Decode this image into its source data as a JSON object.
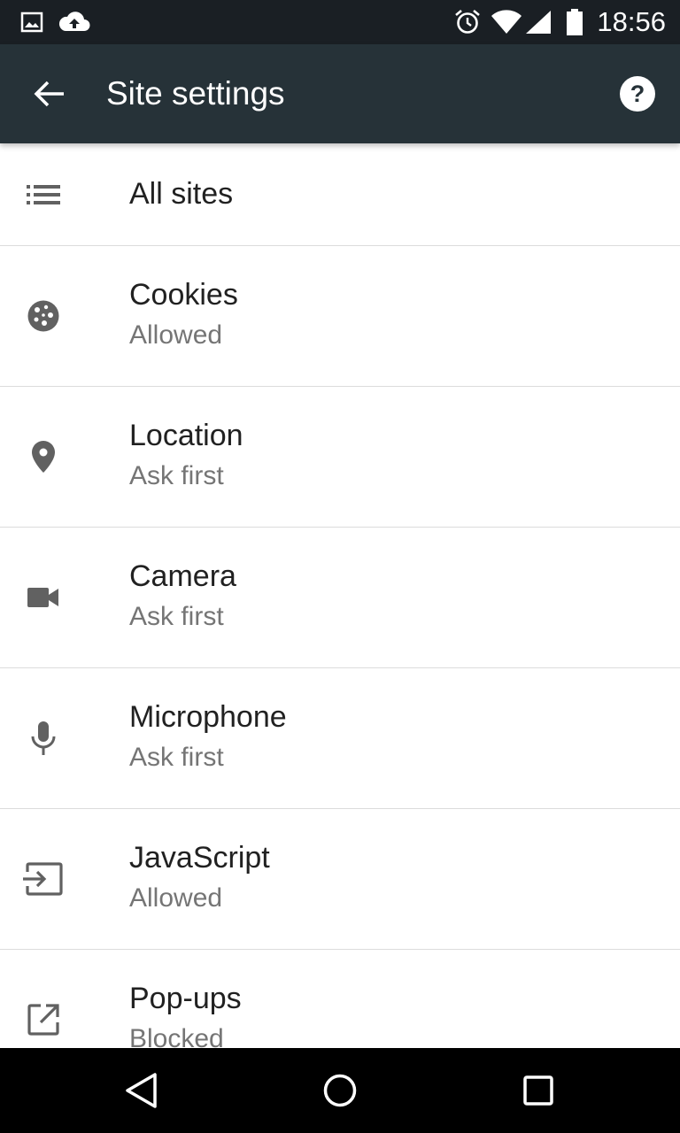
{
  "status_bar": {
    "time": "18:56",
    "left_icons": [
      "image-icon",
      "cloud-upload-icon"
    ],
    "right_icons": [
      "alarm-icon",
      "wifi-icon",
      "signal-icon",
      "battery-icon"
    ]
  },
  "toolbar": {
    "title": "Site settings",
    "back_icon": "arrow-back-icon",
    "help_icon": "help-icon"
  },
  "settings": {
    "items": [
      {
        "icon": "list-icon",
        "title": "All sites"
      },
      {
        "icon": "cookie-icon",
        "title": "Cookies",
        "summary": "Allowed"
      },
      {
        "icon": "location-pin-icon",
        "title": "Location",
        "summary": "Ask first"
      },
      {
        "icon": "videocam-icon",
        "title": "Camera",
        "summary": "Ask first"
      },
      {
        "icon": "microphone-icon",
        "title": "Microphone",
        "summary": "Ask first"
      },
      {
        "icon": "javascript-icon",
        "title": "JavaScript",
        "summary": "Allowed"
      },
      {
        "icon": "open-in-new-icon",
        "title": "Pop-ups",
        "summary": "Blocked"
      }
    ]
  },
  "nav_bar": {
    "buttons": [
      "back-triangle-icon",
      "home-circle-icon",
      "recents-square-icon"
    ]
  },
  "colors": {
    "status_bar": "#1a1f24",
    "toolbar": "#263238",
    "title_text": "#212121",
    "summary_text": "#757575",
    "icon": "#616161",
    "divider": "#dcdcdc"
  }
}
